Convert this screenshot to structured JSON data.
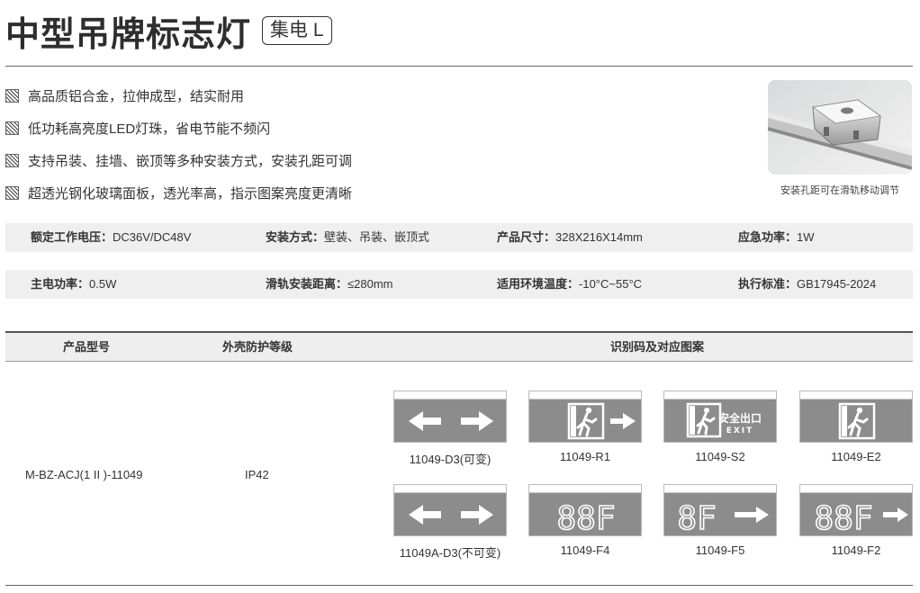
{
  "header": {
    "title": "中型吊牌标志灯",
    "badge": "集电 L"
  },
  "features": [
    "高品质铝合金，拉伸成型，结实耐用",
    "低功耗高亮度LED灯珠，省电节能不频闪",
    "支持吊装、挂墙、嵌顶等多种安装方式，安装孔距可调",
    "超透光钢化玻璃面板，透光率高，指示图案亮度更清晰"
  ],
  "photo": {
    "caption": "安装孔距可在滑轨移动调节"
  },
  "specs": {
    "row1": [
      {
        "label": "额定工作电压：",
        "value": "DC36V/DC48V"
      },
      {
        "label": "安装方式：",
        "value": "壁装、吊装、嵌顶式"
      },
      {
        "label": "产品尺寸：",
        "value": "328X216X14mm"
      },
      {
        "label": "应急功率：",
        "value": "1W"
      }
    ],
    "row2": [
      {
        "label": "主电功率：",
        "value": "0.5W"
      },
      {
        "label": "滑轨安装距离：",
        "value": "≤280mm"
      },
      {
        "label": "适用环境温度：",
        "value": "-10°C~55°C"
      },
      {
        "label": "执行标准：",
        "value": "GB17945-2024"
      }
    ]
  },
  "table": {
    "headers": [
      "产品型号",
      "外壳防护等级",
      "识别码及对应图案"
    ],
    "model": "M-BZ-ACJ(1 II )-11049",
    "ip": "IP42",
    "signs": [
      {
        "code": "11049-D3(可变)",
        "pattern": "double-arrow"
      },
      {
        "code": "11049-R1",
        "pattern": "exit-man-arrow-right"
      },
      {
        "code": "11049-S2",
        "pattern": "exit-man-safety-text",
        "glyph_text": "安全出口",
        "exit_text": "EXIT"
      },
      {
        "code": "11049-E2",
        "pattern": "exit-man"
      },
      {
        "code": "11049A-D3(不可变)",
        "pattern": "double-arrow"
      },
      {
        "code": "11049-F4",
        "pattern": "digits",
        "digits": "88F"
      },
      {
        "code": "11049-F5",
        "pattern": "digits-arrow",
        "digits": "8F"
      },
      {
        "code": "11049-F2",
        "pattern": "digits-arrow",
        "digits": "88F"
      }
    ]
  }
}
